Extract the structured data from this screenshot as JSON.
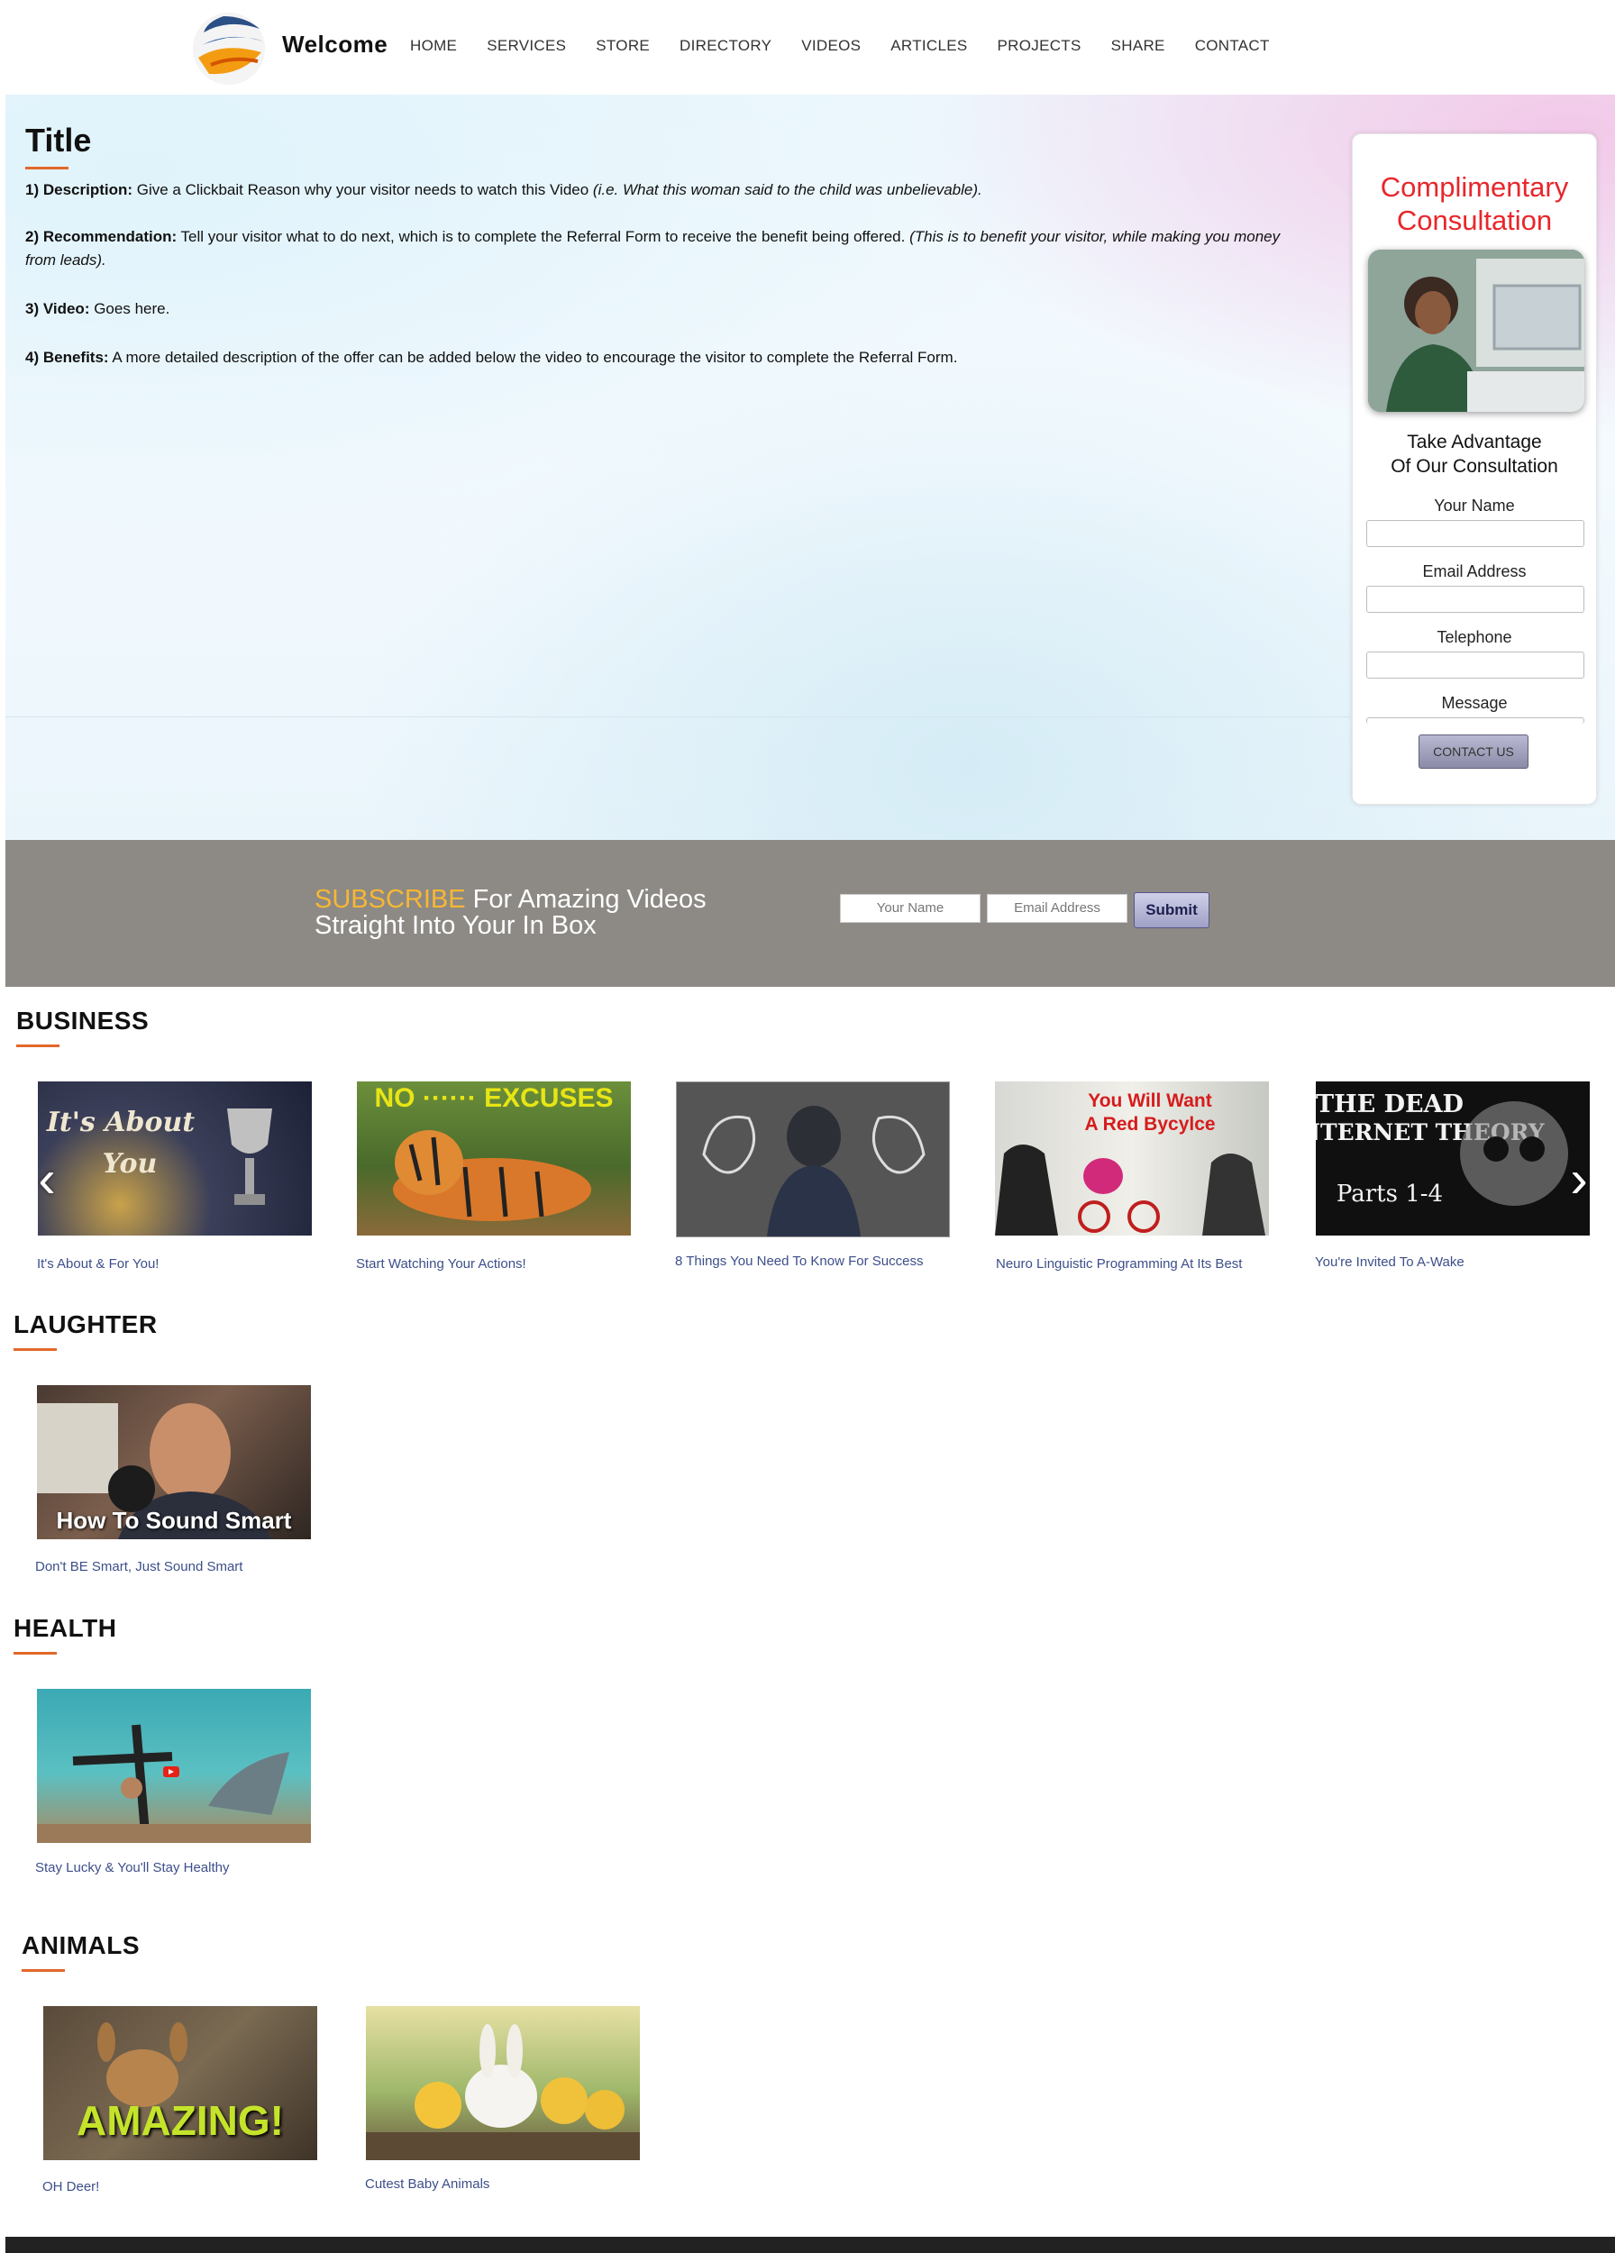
{
  "header": {
    "site_title": "Welcome",
    "nav": [
      "HOME",
      "SERVICES",
      "STORE",
      "DIRECTORY",
      "VIDEOS",
      "ARTICLES",
      "PROJECTS",
      "SHARE",
      "CONTACT"
    ]
  },
  "content": {
    "title": "Title",
    "p1_label": "1) Description:",
    "p1_text": " Give a Clickbait Reason why your visitor needs to watch this Video ",
    "p1_italic": "(i.e. What this woman said to the child was unbelievable).",
    "p2_label": "2) Recommendation:",
    "p2_text": " Tell your visitor what to do next, which is to complete the Referral Form to receive the benefit being offered. ",
    "p2_italic": "(This is to benefit your visitor, while making you money from leads).",
    "p3_label": "3) Video:",
    "p3_text": " Goes here.",
    "p4_label": "4) Benefits:",
    "p4_text": " A more detailed description of the offer can be added below the video to encourage the visitor to complete the Referral Form."
  },
  "consultation": {
    "title_line1": "Complimentary",
    "title_line2": "Consultation",
    "sub_line1": "Take Advantage",
    "sub_line2": "Of Our Consultation",
    "name_label": "Your Name",
    "email_label": "Email Address",
    "phone_label": "Telephone",
    "message_label": "Message",
    "button": "CONTACT US"
  },
  "subscribe": {
    "highlight": "SUBSCRIBE",
    "line1_rest": " For Amazing Videos",
    "line2": "Straight Into Your In Box",
    "name_placeholder": "Your Name",
    "email_placeholder": "Email Address",
    "submit": "Submit"
  },
  "business": {
    "heading": "BUSINESS",
    "items": [
      {
        "caption": "It's About & For You!",
        "overlay1": "It's About",
        "overlay2": "You"
      },
      {
        "caption": "Start Watching Your Actions!",
        "overlay": "NO ······ EXCUSES"
      },
      {
        "caption": "8 Things You Need To Know For Success"
      },
      {
        "caption": "Neuro Linguistic Programming At Its Best",
        "overlay1": "You Will Want",
        "overlay2": "A Red Bycylce"
      },
      {
        "caption": "You're Invited To A-Wake",
        "overlay1": "THE DEAD",
        "overlay2": "INTERNET THEORY",
        "overlay3": "Parts 1-4"
      }
    ]
  },
  "laughter": {
    "heading": "LAUGHTER",
    "items": [
      {
        "caption": "Don't BE Smart, Just Sound Smart",
        "overlay": "How To Sound Smart"
      }
    ]
  },
  "health": {
    "heading": "HEALTH",
    "items": [
      {
        "caption": "Stay Lucky & You'll Stay Healthy"
      }
    ]
  },
  "animals": {
    "heading": "ANIMALS",
    "items": [
      {
        "caption": "OH Deer!",
        "overlay": "AMAZING!"
      },
      {
        "caption": "Cutest Baby Animals"
      }
    ]
  },
  "colors": {
    "accent_underline": "#e2682b",
    "consult_title": "#e8262b",
    "subscribe_bg": "#8d8a85",
    "subscribe_highlight": "#f7b733",
    "caption_text": "#3d4f8a"
  }
}
